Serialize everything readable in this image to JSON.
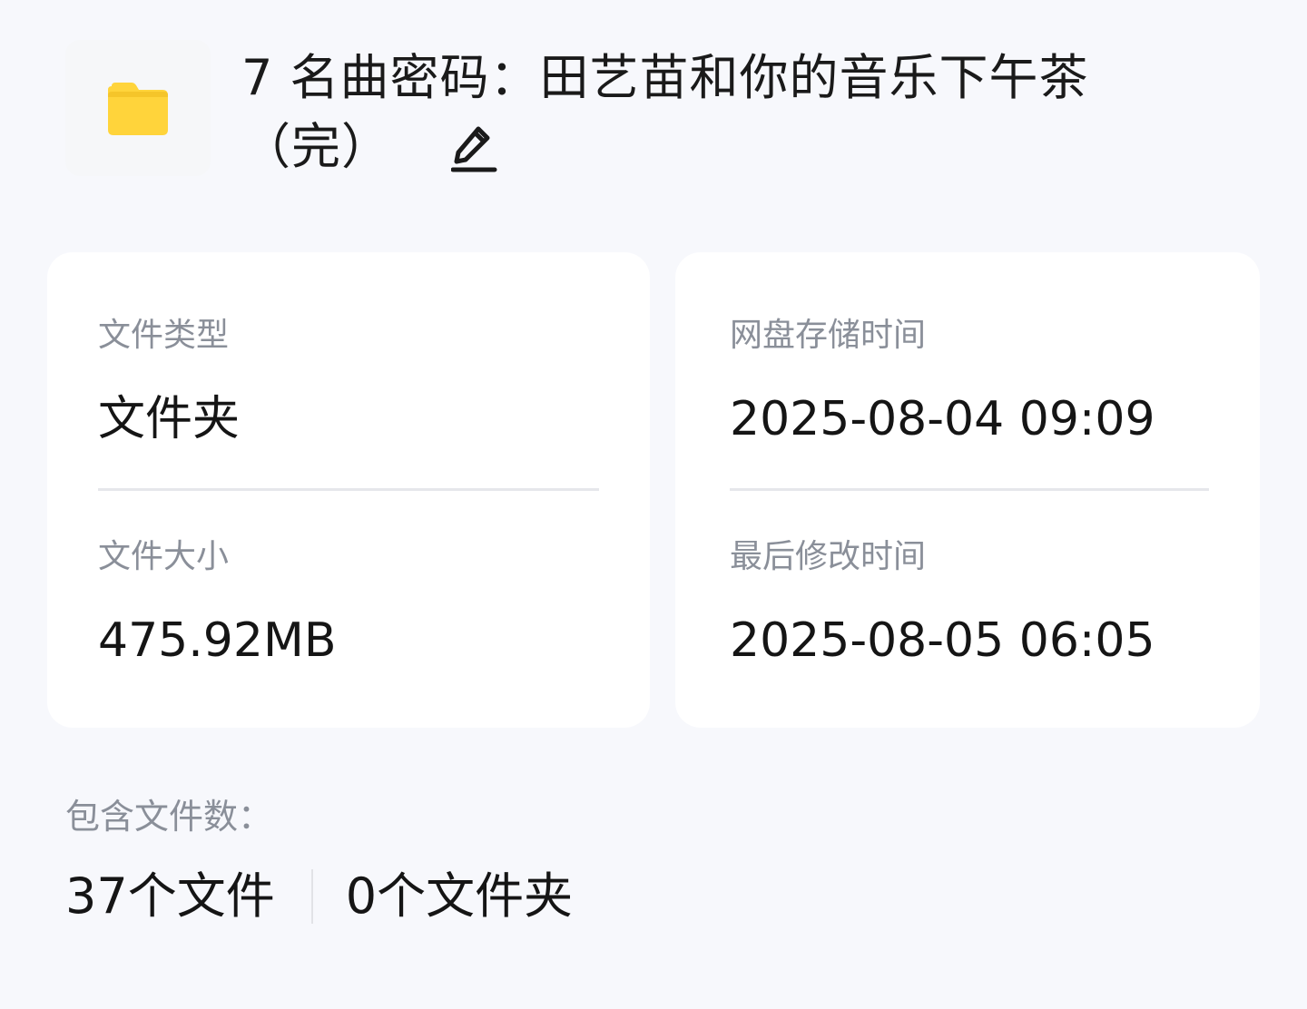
{
  "header": {
    "title": "7 名曲密码：田艺苗和你的音乐下午茶（完）",
    "folder_icon": "folder-icon",
    "edit_icon": "pencil-icon",
    "folder_color": "#FFD43B"
  },
  "info": {
    "file_type": {
      "label": "文件类型",
      "value": "文件夹"
    },
    "storage_time": {
      "label": "网盘存储时间",
      "value": "2025-08-04 09:09"
    },
    "file_size": {
      "label": "文件大小",
      "value": "475.92MB"
    },
    "modified_time": {
      "label": "最后修改时间",
      "value": "2025-08-05 06:05"
    }
  },
  "contains": {
    "label": "包含文件数：",
    "files": "37个文件",
    "folders": "0个文件夹"
  }
}
